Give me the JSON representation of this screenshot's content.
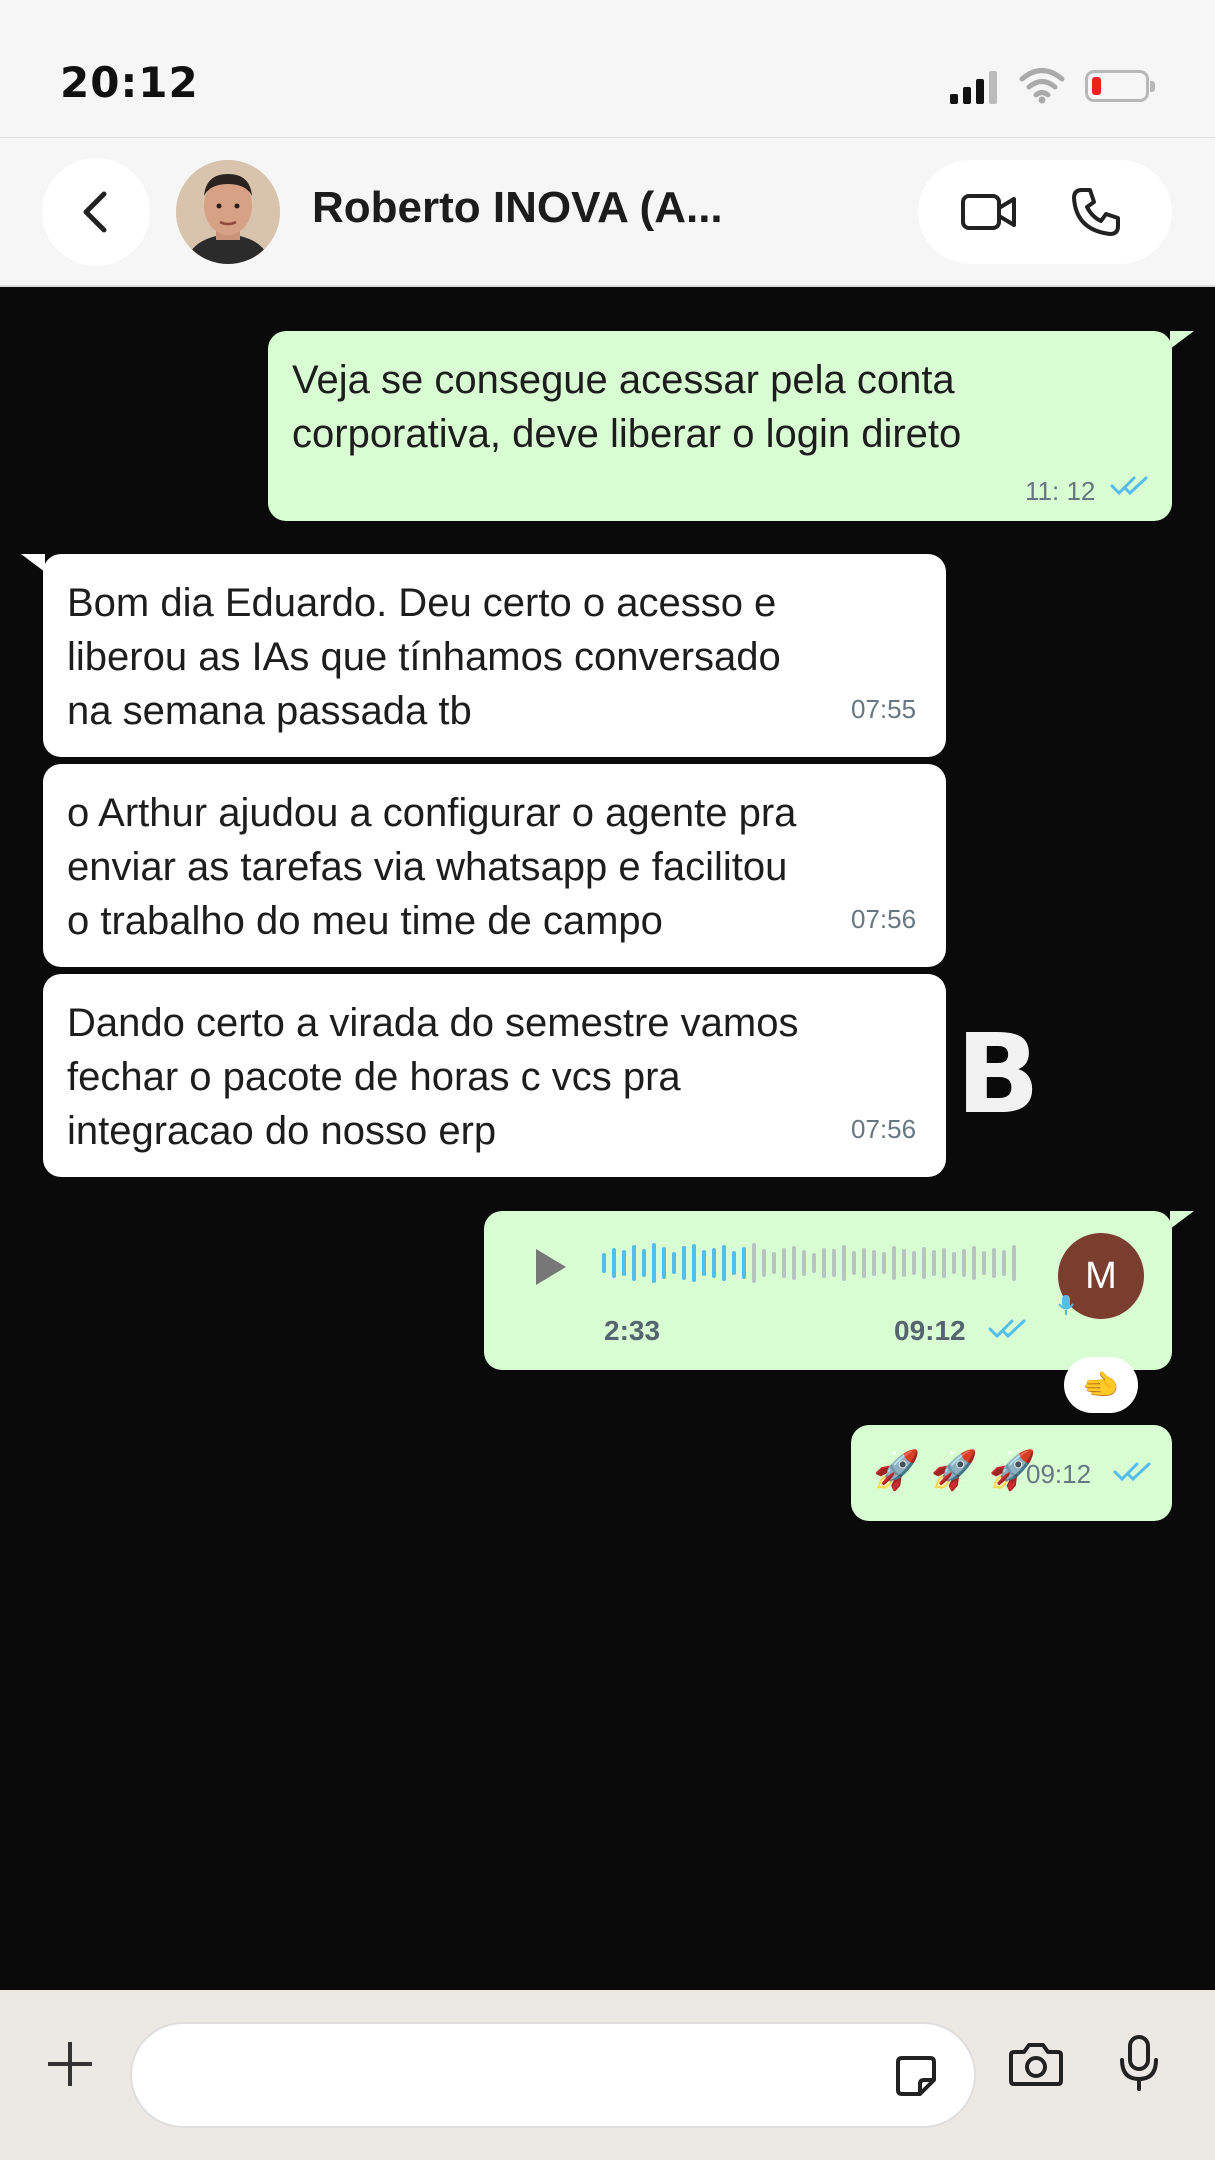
{
  "status_bar": {
    "time": "20:12"
  },
  "header": {
    "contact_name": "Roberto INOVA (A...",
    "back_icon": "chevron-left-icon",
    "video_icon": "video-camera-icon",
    "phone_icon": "phone-icon"
  },
  "messages": [
    {
      "direction": "outgoing",
      "text": "Veja se consegue acessar pela conta\ncorporativa, deve liberar o login direto",
      "time": "11: 12",
      "status": "read"
    },
    {
      "direction": "incoming",
      "text": "Bom dia Eduardo. Deu certo o acesso e\nliberou as IAs que tínhamos conversado\nna semana passada tb",
      "time": "07:55"
    },
    {
      "direction": "incoming",
      "text": "o Arthur ajudou a configurar o agente pra\nenviar as tarefas via whatsapp e facilitou\no trabalho do meu time de campo",
      "time": "07:56"
    },
    {
      "direction": "incoming",
      "text": "Dando certo a virada do semestre vamos\nfechar o pacote de horas c vcs pra\nintegracao do nosso erp",
      "time": "07:56"
    }
  ],
  "voice_message": {
    "duration": "2:33",
    "time": "09:12",
    "avatar_initial": "M",
    "status": "read",
    "played_fraction": 0.36
  },
  "reaction": {
    "emoji": "🫲"
  },
  "emoji_message": {
    "text": "🚀 🚀 🚀",
    "time": "09:12",
    "status": "read"
  },
  "watermark": "B",
  "colors": {
    "outgoing_bubble": "#d9fdd3",
    "incoming_bubble": "#ffffff",
    "chat_background": "#0a0a0a",
    "read_ticks": "#53bdeb",
    "avatar_bg": "#7a3d2e"
  },
  "input_bar": {
    "value": "",
    "placeholder": ""
  }
}
